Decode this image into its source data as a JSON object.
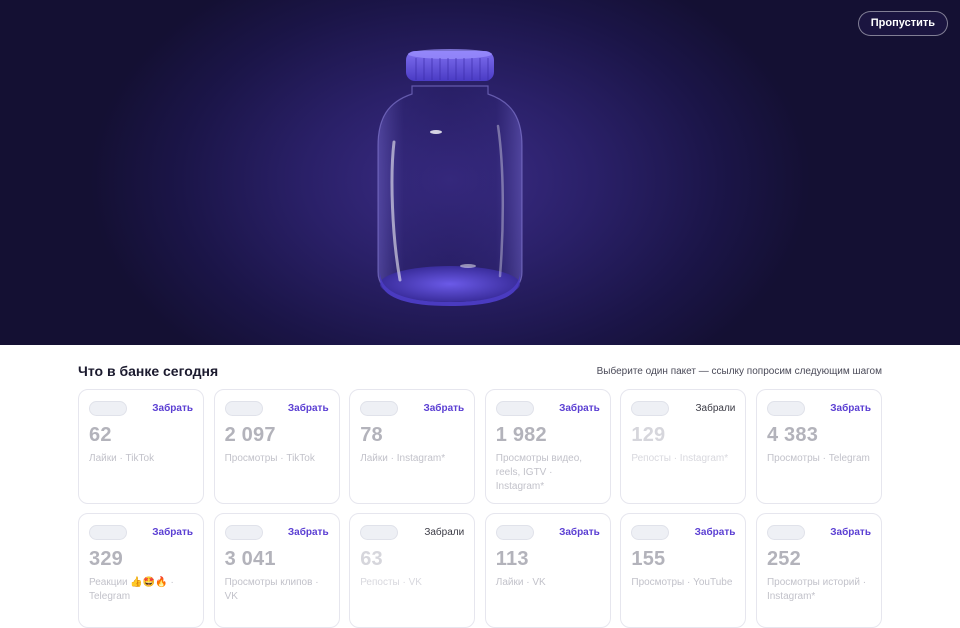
{
  "hero": {
    "skip_label": "Пропустить"
  },
  "section": {
    "title": "Что в банке сегодня",
    "hint": "Выберите один пакет — ссылку попросим следующим шагом"
  },
  "cards": [
    {
      "action": "Забрать",
      "taken": false,
      "number": "62",
      "label": "Лайки · TikTok"
    },
    {
      "action": "Забрать",
      "taken": false,
      "number": "2 097",
      "label": "Просмотры · TikTok"
    },
    {
      "action": "Забрать",
      "taken": false,
      "number": "78",
      "label": "Лайки · Instagram*"
    },
    {
      "action": "Забрать",
      "taken": false,
      "number": "1 982",
      "label": "Просмотры видео, reels, IGTV · Instagram*"
    },
    {
      "action": "Забрали",
      "taken": true,
      "number": "129",
      "label": "Репосты · Instagram*"
    },
    {
      "action": "Забрать",
      "taken": false,
      "number": "4 383",
      "label": "Просмотры · Telegram"
    },
    {
      "action": "Забрать",
      "taken": false,
      "number": "329",
      "label": "Реакции 👍🤩🔥 · Telegram"
    },
    {
      "action": "Забрать",
      "taken": false,
      "number": "3 041",
      "label": "Просмотры клипов · VK"
    },
    {
      "action": "Забрали",
      "taken": true,
      "number": "63",
      "label": "Репосты · VK"
    },
    {
      "action": "Забрать",
      "taken": false,
      "number": "113",
      "label": "Лайки · VK"
    },
    {
      "action": "Забрать",
      "taken": false,
      "number": "155",
      "label": "Просмотры · YouTube"
    },
    {
      "action": "Забрать",
      "taken": false,
      "number": "252",
      "label": "Просмотры историй · Instagram*"
    }
  ]
}
